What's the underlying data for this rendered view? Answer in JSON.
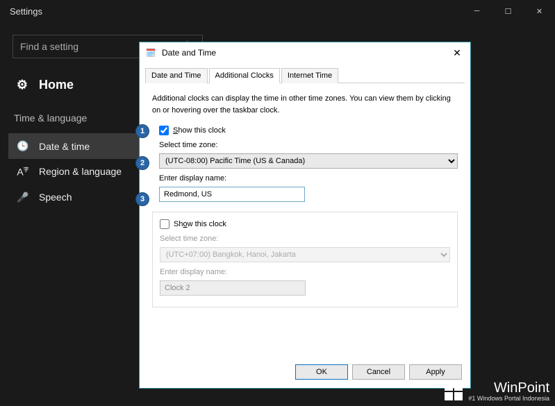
{
  "settings": {
    "title": "Settings",
    "search_placeholder": "Find a setting",
    "home_label": "Home",
    "section": "Time & language",
    "nav": [
      {
        "icon": "🕒",
        "label": "Date & time",
        "selected": true
      },
      {
        "icon": "A",
        "label": "Region & language",
        "selected": false
      },
      {
        "icon": "🎤",
        "label": "Speech",
        "selected": false
      }
    ]
  },
  "dialog": {
    "title": "Date and Time",
    "tabs": [
      "Date and Time",
      "Additional Clocks",
      "Internet Time"
    ],
    "active_tab": 1,
    "help_text": "Additional clocks can display the time in other time zones. You can view them by clicking on or hovering over the taskbar clock.",
    "clocks": [
      {
        "show_label": "Show this clock",
        "show_checked": true,
        "tz_label": "Select time zone:",
        "tz_value": "(UTC-08:00) Pacific Time (US & Canada)",
        "dname_label": "Enter display name:",
        "dname_value": "Redmond, US",
        "disabled": false
      },
      {
        "show_label": "Show this clock",
        "show_checked": false,
        "tz_label": "Select time zone:",
        "tz_value": "(UTC+07:00) Bangkok, Hanoi, Jakarta",
        "dname_label": "Enter display name:",
        "dname_value": "Clock 2",
        "disabled": true
      }
    ],
    "buttons": {
      "ok": "OK",
      "cancel": "Cancel",
      "apply": "Apply"
    }
  },
  "markers": [
    "1",
    "2",
    "3"
  ],
  "watermark": {
    "name": "WinPoint",
    "sub": "#1 Windows Portal Indonesia"
  }
}
